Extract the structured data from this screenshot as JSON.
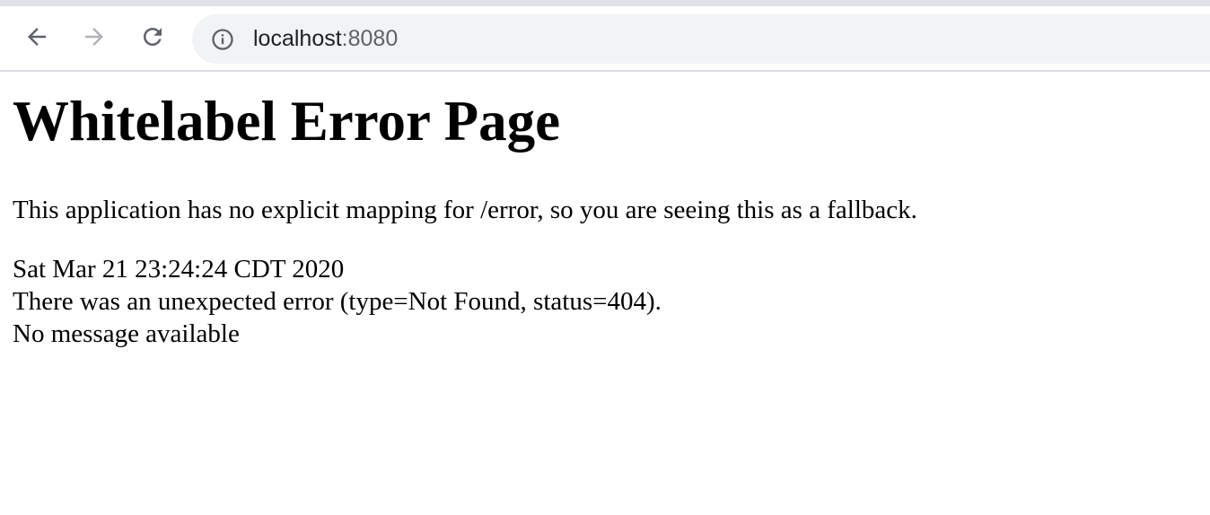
{
  "browser": {
    "address_bar": {
      "host": "localhost",
      "port": ":8080"
    },
    "icons": {
      "back": "back-arrow-icon",
      "forward": "forward-arrow-icon",
      "reload": "reload-icon",
      "site_info": "info-icon"
    }
  },
  "page": {
    "heading": "Whitelabel Error Page",
    "explanation": "This application has no explicit mapping for /error, so you are seeing this as a fallback.",
    "timestamp": "Sat Mar 21 23:24:24 CDT 2020",
    "error_line": "There was an unexpected error (type=Not Found, status=404).",
    "message": "No message available"
  }
}
